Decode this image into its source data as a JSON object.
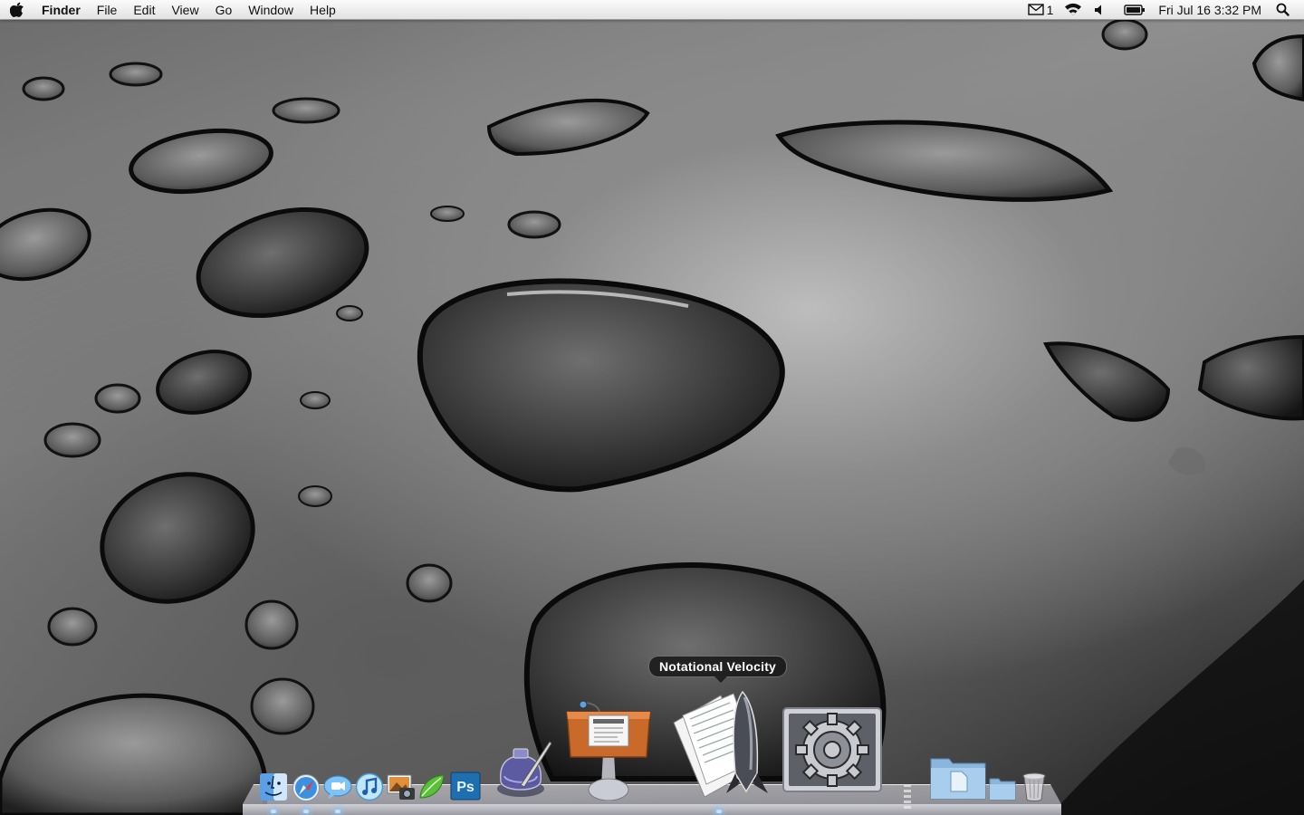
{
  "menubar": {
    "app_name": "Finder",
    "menus": [
      "File",
      "Edit",
      "View",
      "Go",
      "Window",
      "Help"
    ],
    "mail_count": "1",
    "clock": "Fri Jul 16  3:32 PM"
  },
  "dock": {
    "tooltip": "Notational Velocity",
    "apps": [
      "finder",
      "safari",
      "ichat",
      "itunes",
      "iphoto",
      "coda",
      "photoshop",
      "quill",
      "keynote",
      "notational-velocity",
      "system-preferences",
      "folder",
      "downloads-folder",
      "trash"
    ],
    "running": [
      "finder",
      "safari",
      "ichat",
      "notational-velocity"
    ]
  },
  "colors": {
    "menubar": "#ececec",
    "accent_running": "#bfe3ff",
    "tooltip_bg": "#141414"
  }
}
